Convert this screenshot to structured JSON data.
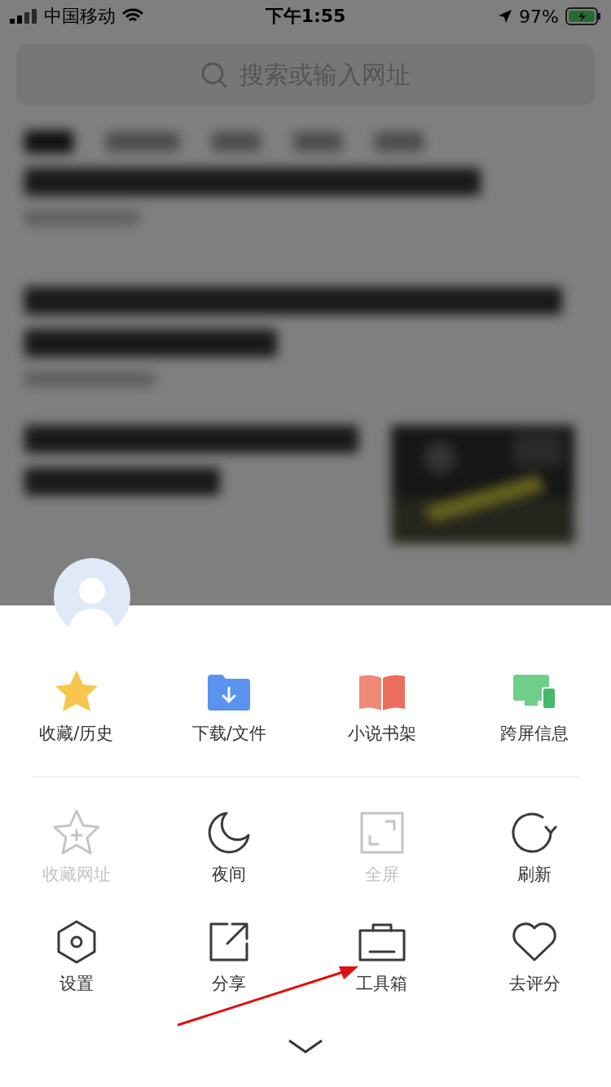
{
  "status_bar": {
    "carrier": "中国移动",
    "time": "下午1:55",
    "battery": "97%"
  },
  "search": {
    "placeholder": "搜索或输入网址"
  },
  "primary_items": [
    {
      "label": "收藏/历史"
    },
    {
      "label": "下载/文件"
    },
    {
      "label": "小说书架"
    },
    {
      "label": "跨屏信息"
    }
  ],
  "tool_items": [
    {
      "label": "收藏网址",
      "disabled": true
    },
    {
      "label": "夜间",
      "disabled": false
    },
    {
      "label": "全屏",
      "disabled": true
    },
    {
      "label": "刷新",
      "disabled": false
    },
    {
      "label": "设置",
      "disabled": false
    },
    {
      "label": "分享",
      "disabled": false
    },
    {
      "label": "工具箱",
      "disabled": false
    },
    {
      "label": "去评分",
      "disabled": false
    }
  ]
}
